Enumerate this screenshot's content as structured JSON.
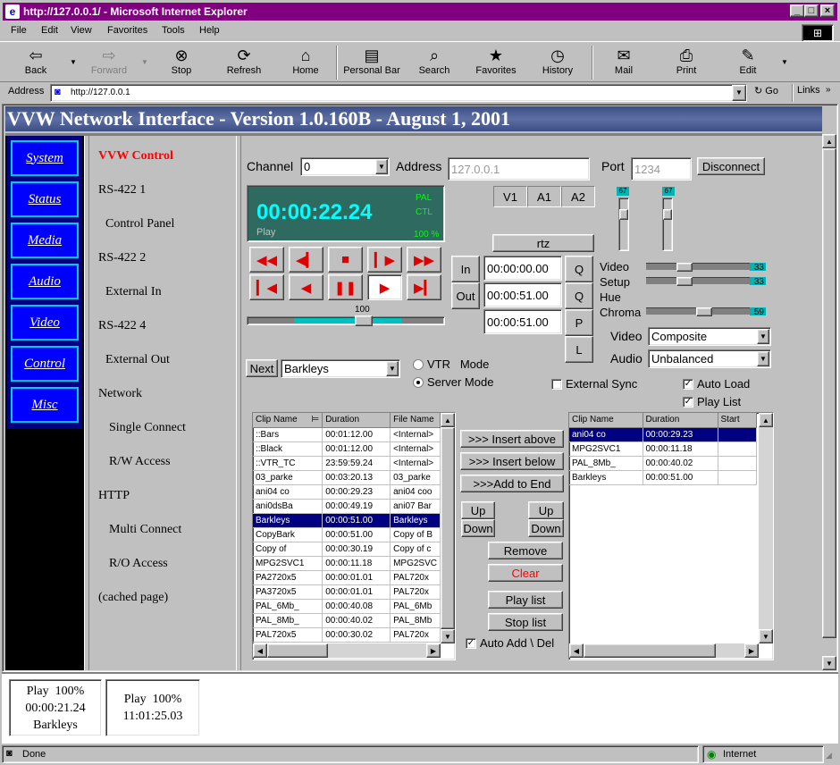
{
  "window": {
    "title": "http://127.0.0.1/ - Microsoft Internet Explorer"
  },
  "menu": [
    "File",
    "Edit",
    "View",
    "Favorites",
    "Tools",
    "Help"
  ],
  "toolbar": [
    {
      "label": "Back",
      "icon": "back-arrow-icon",
      "glyph": "⇦"
    },
    {
      "label": "Forward",
      "icon": "forward-arrow-icon",
      "glyph": "⇨"
    },
    {
      "label": "Stop",
      "icon": "stop-icon",
      "glyph": "⊗"
    },
    {
      "label": "Refresh",
      "icon": "refresh-icon",
      "glyph": "⟳"
    },
    {
      "label": "Home",
      "icon": "home-icon",
      "glyph": "⌂"
    },
    {
      "label": "Personal Bar",
      "icon": "personal-bar-icon",
      "glyph": "▤"
    },
    {
      "label": "Search",
      "icon": "search-icon",
      "glyph": "⌕"
    },
    {
      "label": "Favorites",
      "icon": "favorites-icon",
      "glyph": "★"
    },
    {
      "label": "History",
      "icon": "history-icon",
      "glyph": "◷"
    },
    {
      "label": "Mail",
      "icon": "mail-icon",
      "glyph": "✉"
    },
    {
      "label": "Print",
      "icon": "print-icon",
      "glyph": "⎙"
    },
    {
      "label": "Edit",
      "icon": "edit-icon",
      "glyph": "✎"
    }
  ],
  "address": {
    "label": "Address",
    "value": "http://127.0.0.1",
    "go": "Go",
    "links": "Links"
  },
  "banner": "VVW Network Interface - Version 1.0.160B - August 1, 2001",
  "nav": [
    "System",
    "Status",
    "Media",
    "Audio",
    "Video",
    "Control",
    "Misc"
  ],
  "subnav": [
    {
      "label": "VVW Control",
      "active": true
    },
    {
      "label": "RS-422 1",
      "indent": false
    },
    {
      "label": "Control Panel",
      "indent": true
    },
    {
      "label": "RS-422 2",
      "indent": false
    },
    {
      "label": "External In",
      "indent": true
    },
    {
      "label": "RS-422 4",
      "indent": false
    },
    {
      "label": "External Out",
      "indent": true
    },
    {
      "label": "Network",
      "indent": false
    },
    {
      "label": "Single Connect",
      "indent": true
    },
    {
      "label": "R/W Access",
      "indent": true
    },
    {
      "label": "HTTP",
      "indent": false
    },
    {
      "label": "Multi Connect",
      "indent": true
    },
    {
      "label": "R/O Access",
      "indent": true
    },
    {
      "label": "(cached page)",
      "indent": false
    }
  ],
  "control": {
    "channel_label": "Channel",
    "channel_value": "0",
    "address_label": "Address",
    "address_value": "127.0.0.1",
    "port_label": "Port",
    "port_value": "1234",
    "disconnect": "Disconnect",
    "timecode": "00:00:22.24",
    "format": "PAL",
    "mode": "CTL",
    "state": "Play",
    "speed": "100 %",
    "tracks": [
      "V1",
      "A1",
      "A2"
    ],
    "rtz": "rtz",
    "in": "In",
    "out": "Out",
    "tc_in": "00:00:00.00",
    "tc_out": "00:00:51.00",
    "tc_dur": "00:00:51.00",
    "qbtns": [
      "Q",
      "Q",
      "P",
      "L"
    ],
    "shuttle_label": "100",
    "audio_levels": [
      "67",
      "67"
    ],
    "next": "Next",
    "clip_select": "Barkleys",
    "vtr_mode": "VTR   Mode",
    "server_mode": "Server Mode",
    "proc": [
      {
        "label": "Video",
        "value": "33"
      },
      {
        "label": "Setup",
        "value": "33"
      },
      {
        "label": "Hue",
        "value": ""
      },
      {
        "label": "Chroma",
        "value": "59"
      }
    ],
    "video_label": "Video",
    "video_value": "Composite",
    "audio_label": "Audio",
    "audio_value": "Unbalanced",
    "ext_sync": "External Sync",
    "auto_load": "Auto Load",
    "play_list": "Play List",
    "auto_add": "Auto Add \\ Del"
  },
  "clips": {
    "headers": [
      "Clip Name",
      "Duration",
      "File Name"
    ],
    "rows": [
      [
        "::Bars",
        "00:01:12.00",
        "<Internal>"
      ],
      [
        "::Black",
        "00:01:12.00",
        "<Internal>"
      ],
      [
        "::VTR_TC",
        "23:59:59.24",
        "<Internal>"
      ],
      [
        "03_parke",
        "00:03:20.13",
        "03_parke"
      ],
      [
        "ani04 co",
        "00:00:29.23",
        "ani04 coo"
      ],
      [
        "ani0dsBa",
        "00:00:49.19",
        "ani07 Bar"
      ],
      [
        "Barkleys",
        "00:00:51.00",
        "Barkleys"
      ],
      [
        "CopyBark",
        "00:00:51.00",
        "Copy of B"
      ],
      [
        "Copy of",
        "00:00:30.19",
        "Copy of c"
      ],
      [
        "MPG2SVC1",
        "00:00:11.18",
        "MPG2SVC"
      ],
      [
        "PA2720x5",
        "00:00:01.01",
        "PAL720x"
      ],
      [
        "PA3720x5",
        "00:00:01.01",
        "PAL720x"
      ],
      [
        "PAL_6Mb_",
        "00:00:40.08",
        "PAL_6Mb"
      ],
      [
        "PAL_8Mb_",
        "00:00:40.02",
        "PAL_8Mb"
      ],
      [
        "PAL720x5",
        "00:00:30.02",
        "PAL720x"
      ]
    ],
    "selected": 6
  },
  "listbtns": {
    "insert_above": ">>> Insert above",
    "insert_below": ">>> Insert below",
    "add_end": ">>>Add to End",
    "up": "Up",
    "down": "Down",
    "remove": "Remove",
    "clear": "Clear",
    "play_list": "Play list",
    "stop_list": "Stop list"
  },
  "playlist": {
    "headers": [
      "Clip Name",
      "Duration",
      "Start"
    ],
    "rows": [
      [
        "ani04 co",
        "00:00:29.23",
        ""
      ],
      [
        "MPG2SVC1",
        "00:00:11.18",
        ""
      ],
      [
        "PAL_8Mb_",
        "00:00:40.02",
        ""
      ],
      [
        "Barkleys",
        "00:00:51.00",
        ""
      ]
    ],
    "selected": 0
  },
  "status_cells": [
    {
      "lines": [
        "Play  100%",
        "00:00:21.24",
        "Barkleys"
      ]
    },
    {
      "lines": [
        "Play  100%",
        "11:01:25.03"
      ]
    }
  ],
  "statusbar": {
    "left": "Done",
    "zone": "Internet"
  },
  "colors": {
    "title": "#800080",
    "nav": "#0000ff",
    "accent": "#ff0000",
    "timecode": "#00ffff",
    "display": "#2e6a60"
  }
}
